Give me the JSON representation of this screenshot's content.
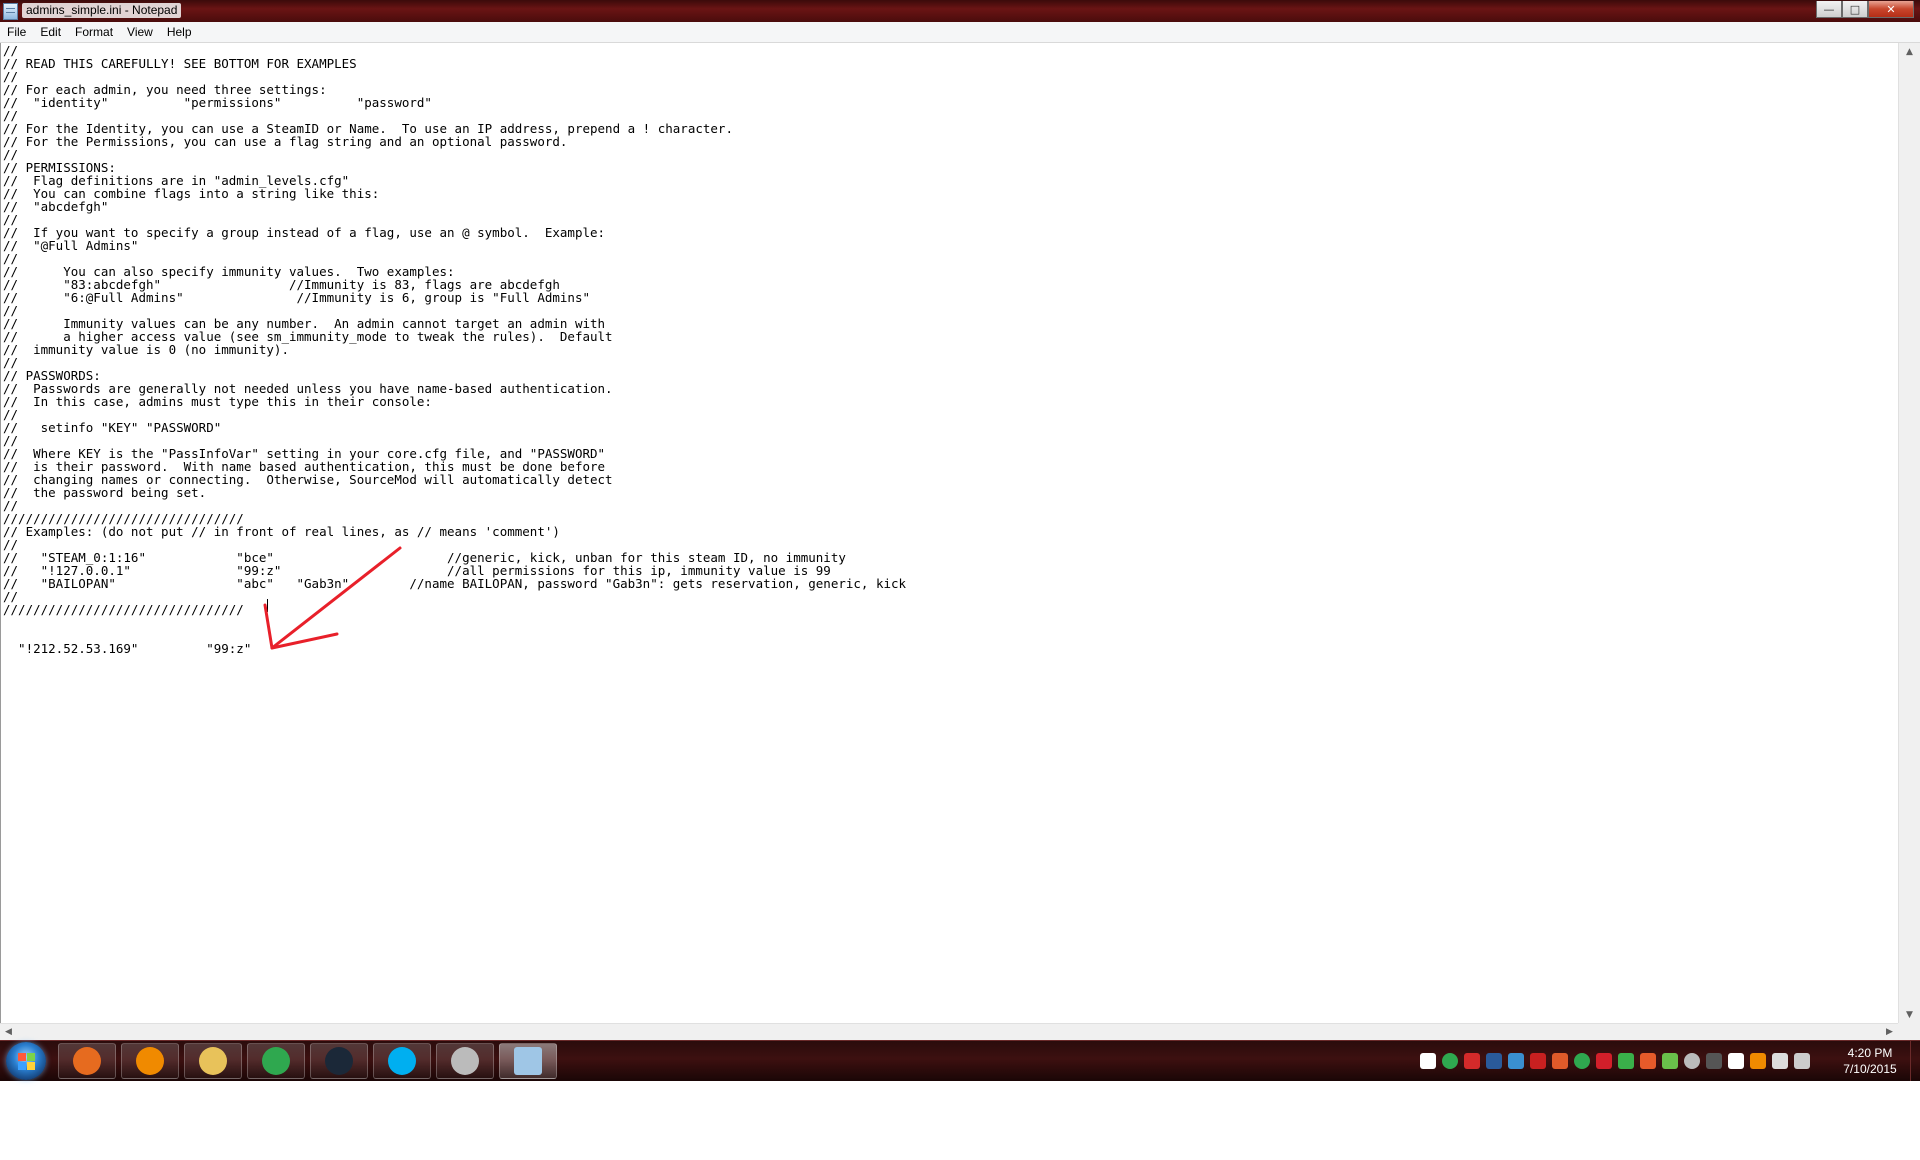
{
  "window": {
    "title": "admins_simple.ini - Notepad",
    "controls": {
      "minimize": "—",
      "maximize": "□",
      "close": "✕"
    }
  },
  "menu": [
    "File",
    "Edit",
    "Format",
    "View",
    "Help"
  ],
  "editor": {
    "content": "//\n// READ THIS CAREFULLY! SEE BOTTOM FOR EXAMPLES\n//\n// For each admin, you need three settings:\n//  \"identity\"          \"permissions\"          \"password\"\n//\n// For the Identity, you can use a SteamID or Name.  To use an IP address, prepend a ! character.\n// For the Permissions, you can use a flag string and an optional password.\n//\n// PERMISSIONS:\n//  Flag definitions are in \"admin_levels.cfg\"\n//  You can combine flags into a string like this:\n//  \"abcdefgh\"\n//\n//  If you want to specify a group instead of a flag, use an @ symbol.  Example:\n//  \"@Full Admins\"\n//\n//      You can also specify immunity values.  Two examples:\n//      \"83:abcdefgh\"                 //Immunity is 83, flags are abcdefgh\n//      \"6:@Full Admins\"               //Immunity is 6, group is \"Full Admins\"\n//\n//      Immunity values can be any number.  An admin cannot target an admin with\n//      a higher access value (see sm_immunity_mode to tweak the rules).  Default\n//  immunity value is 0 (no immunity).\n//\n// PASSWORDS:\n//  Passwords are generally not needed unless you have name-based authentication.\n//  In this case, admins must type this in their console:\n//\n//   setinfo \"KEY\" \"PASSWORD\"\n//\n//  Where KEY is the \"PassInfoVar\" setting in your core.cfg file, and \"PASSWORD\"\n//  is their password.  With name based authentication, this must be done before\n//  changing names or connecting.  Otherwise, SourceMod will automatically detect\n//  the password being set.\n//\n////////////////////////////////\n// Examples: (do not put // in front of real lines, as // means 'comment')\n//\n//   \"STEAM_0:1:16\"            \"bce\"                       //generic, kick, unban for this steam ID, no immunity\n//   \"!127.0.0.1\"              \"99:z\"                      //all permissions for this ip, immunity value is 99\n//   \"BAILOPAN\"                \"abc\"   \"Gab3n\"        //name BAILOPAN, password \"Gab3n\": gets reservation, generic, kick\n//\n////////////////////////////////\n\n\n  \"!212.52.53.169\"         \"99:z\""
  },
  "scrollbars": {
    "up": "▲",
    "down": "▼",
    "left": "◀",
    "right": "▶"
  },
  "taskbar": {
    "apps": [
      {
        "name": "firefox",
        "color": "#e66b1f"
      },
      {
        "name": "vlc",
        "color": "#f08a00"
      },
      {
        "name": "explorer",
        "color": "#e8c25a"
      },
      {
        "name": "chrome",
        "color": "#2fa84f"
      },
      {
        "name": "steam",
        "color": "#1b2838"
      },
      {
        "name": "skype",
        "color": "#00aff0"
      },
      {
        "name": "app-avatar",
        "color": "#bbbbbb"
      },
      {
        "name": "notepad",
        "color": "#9fc6e6"
      }
    ],
    "clock": {
      "time": "4:20 PM",
      "date": "7/10/2015"
    }
  },
  "colors": {
    "annotation_arrow": "#e8202a",
    "taskbar": "#2a0c0c"
  }
}
